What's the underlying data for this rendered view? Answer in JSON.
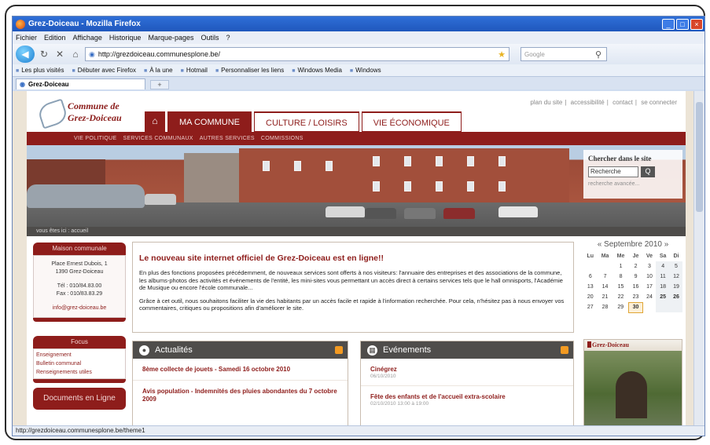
{
  "window": {
    "title": "Grez-Doiceau - Mozilla Firefox",
    "controls": [
      "_",
      "□",
      "×"
    ]
  },
  "menu": [
    "Fichier",
    "Edition",
    "Affichage",
    "Historique",
    "Marque-pages",
    "Outils",
    "?"
  ],
  "nav": {
    "url": "http://grezdoiceau.communesplone.be/",
    "search_placeholder": "Google"
  },
  "bookmarks": [
    "Les plus visités",
    "Débuter avec Firefox",
    "À la une",
    "Hotmail",
    "Personnaliser les liens",
    "Windows Media",
    "Windows"
  ],
  "tab": {
    "label": "Grez-Doiceau",
    "new": "+"
  },
  "site": {
    "logo_line1": "Commune de",
    "logo_line2": "Grez-Doiceau",
    "toplinks": [
      "plan du site",
      "accessibilité",
      "contact",
      "se connecter"
    ],
    "main_tabs": [
      "MA COMMUNE",
      "CULTURE / LOISIRS",
      "VIE ÉCONOMIQUE"
    ],
    "sub_nav": [
      "VIE POLITIQUE",
      "SERVICES COMMUNAUX",
      "AUTRES SERVICES",
      "COMMISSIONS"
    ],
    "breadcrumbs": "vous êtes ici : accueil",
    "search": {
      "heading": "Chercher dans le site",
      "value": "Recherche",
      "button": "Q",
      "advanced": "recherche avancée..."
    },
    "contact": {
      "heading": "Maison communale",
      "address1": "Place Ernest Dubois, 1",
      "address2": "1390 Grez-Doiceau",
      "tel": "Tél : 010/84.83.00",
      "fax": "Fax : 010/83.83.29",
      "email": "info@grez-doiceau.be"
    },
    "focus": {
      "heading": "Focus",
      "items": [
        "Enseignement",
        "Bulletin communal",
        "Renseignements utiles"
      ]
    },
    "documents": "Documents en Ligne",
    "news": {
      "title": "Le nouveau site internet officiel de Grez-Doiceau est en ligne!!",
      "p1": "En plus des fonctions proposées précédemment, de nouveaux services sont offerts à nos visiteurs: l'annuaire des entreprises et des associations de la commune, les albums-photos des activités et événements de l'entité, les mini-sites vous permettant un accès direct à certains services tels que le hall omnisports, l'Académie de Musique ou encore l'école communale...",
      "p2": "Grâce à cet outil, nous souhaitons faciliter la vie des habitants par un accès facile et rapide à l'information recherchée. Pour cela, n'hésitez pas à nous envoyer vos commentaires, critiques ou propositions afin d'améliorer le site."
    },
    "actualites": {
      "heading": "Actualités",
      "items": [
        {
          "title": "8ème collecte de jouets - Samedi 16 octobre 2010",
          "date": ""
        },
        {
          "title": "Avis population - Indemnités des pluies abondantes du 7 octobre 2009",
          "date": ""
        }
      ]
    },
    "evenements": {
      "heading": "Evénements",
      "items": [
        {
          "title": "Cinégrez",
          "date": "06/10/2010"
        },
        {
          "title": "Fête des enfants et de l'accueil extra-scolaire",
          "date": "02/10/2010 13:00 à 19:00"
        }
      ]
    },
    "calendar": {
      "month": "« Septembre 2010 »",
      "days": [
        "Lu",
        "Ma",
        "Me",
        "Je",
        "Ve",
        "Sa",
        "Di"
      ],
      "weeks": [
        [
          "",
          "",
          "1",
          "2",
          "3",
          "4",
          "5"
        ],
        [
          "6",
          "7",
          "8",
          "9",
          "10",
          "11",
          "12"
        ],
        [
          "13",
          "14",
          "15",
          "16",
          "17",
          "18",
          "19"
        ],
        [
          "20",
          "21",
          "22",
          "23",
          "24",
          "25",
          "26"
        ],
        [
          "27",
          "28",
          "29",
          "30",
          "",
          "",
          ""
        ]
      ],
      "today": "30"
    },
    "photo_caption": "Grez-Doiceau"
  },
  "statusbar": "http://grezdoiceau.communesplone.be/theme1",
  "colors": {
    "brand": "#8e1d1b",
    "titlebar": "#1f57bd"
  }
}
